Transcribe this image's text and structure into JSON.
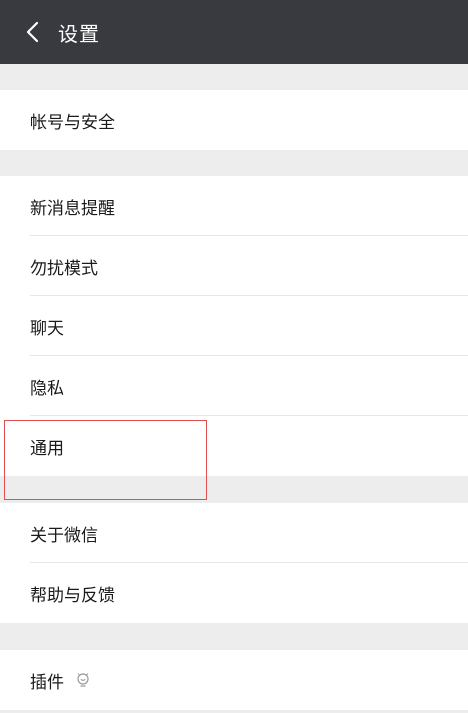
{
  "header": {
    "title": "设置",
    "back_icon": "chevron-left-icon"
  },
  "groups": [
    {
      "items": [
        {
          "label": "帐号与安全"
        }
      ]
    },
    {
      "items": [
        {
          "label": "新消息提醒"
        },
        {
          "label": "勿扰模式"
        },
        {
          "label": "聊天"
        },
        {
          "label": "隐私"
        },
        {
          "label": "通用"
        }
      ]
    },
    {
      "items": [
        {
          "label": "关于微信"
        },
        {
          "label": "帮助与反馈"
        }
      ]
    },
    {
      "items": [
        {
          "label": "插件",
          "icon": "plugin-bulb-icon"
        }
      ]
    }
  ],
  "colors": {
    "topbar": "#393a3f",
    "background": "#ededed",
    "row": "#ffffff",
    "highlight": "#e05050"
  }
}
